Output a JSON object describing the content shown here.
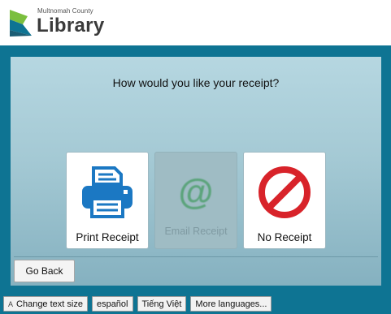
{
  "header": {
    "logo_small": "Multnomah County",
    "logo_big": "Library"
  },
  "prompt": "How would you like your receipt?",
  "options": [
    {
      "label": "Print Receipt",
      "icon": "printer-icon",
      "enabled": true
    },
    {
      "label": "Email Receipt",
      "icon": "at-sign-icon",
      "enabled": false
    },
    {
      "label": "No Receipt",
      "icon": "no-sign-icon",
      "enabled": true
    }
  ],
  "email_icon_glyph": "@",
  "go_back_label": "Go Back",
  "language_bar": {
    "text_size_icon": "A",
    "text_size_label": "Change text size",
    "espanol": "español",
    "vietnamese": "Tiếng Việt",
    "more": "More languages..."
  },
  "colors": {
    "brand_teal": "#0e7493",
    "logo_green": "#7bbf3e",
    "printer_blue": "#1b78c3",
    "no_red": "#d8232a"
  }
}
